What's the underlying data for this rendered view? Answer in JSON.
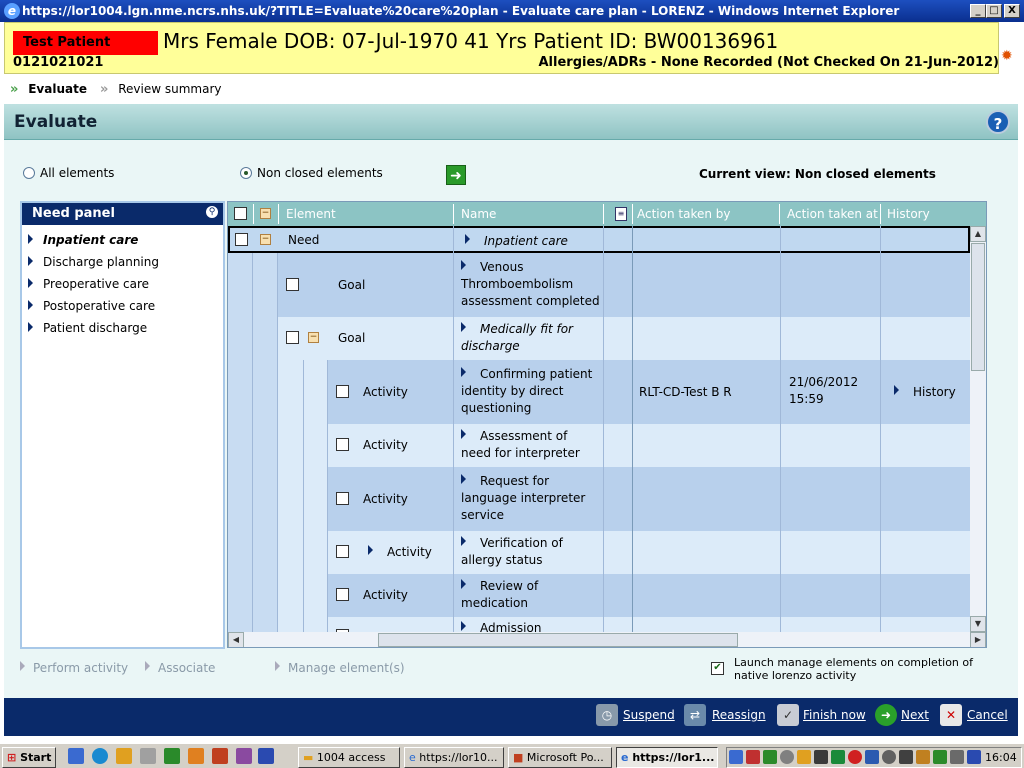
{
  "window": {
    "title": "https://lor1004.lgn.nme.ncrs.nhs.uk/?TITLE=Evaluate%20care%20plan - Evaluate care plan - LORENZ - Windows Internet Explorer",
    "min": "_",
    "max": "□",
    "close": "X"
  },
  "patient": {
    "name": "Test Patient",
    "demographics": "Mrs Female DOB: 07-Jul-1970 41 Yrs Patient ID: BW00136961",
    "nhs_number": "0121021021",
    "allergies": "Allergies/ADRs - None Recorded (Not Checked On 21-Jun-2012)"
  },
  "breadcrumb": [
    {
      "label": "Evaluate",
      "active": true
    },
    {
      "label": "Review summary",
      "active": false
    }
  ],
  "header": {
    "title": "Evaluate",
    "help": "?"
  },
  "filter": {
    "all_label": "All elements",
    "non_closed_label": "Non closed elements",
    "selected": "non_closed",
    "current_view": "Current view: Non closed elements"
  },
  "need_panel": {
    "title": "Need panel",
    "items": [
      {
        "label": "Inpatient care",
        "selected": true
      },
      {
        "label": "Discharge planning",
        "selected": false
      },
      {
        "label": "Preoperative care",
        "selected": false
      },
      {
        "label": "Postoperative care",
        "selected": false
      },
      {
        "label": "Patient discharge",
        "selected": false
      }
    ]
  },
  "grid": {
    "columns": [
      "Element",
      "Name",
      "Action taken by",
      "Action taken at",
      "History"
    ],
    "rows": [
      {
        "element": "Need",
        "name": "Inpatient care",
        "action_by": "",
        "action_at": "",
        "history": ""
      },
      {
        "element": "Goal",
        "name": "Venous Thromboembolism assessment completed",
        "action_by": "",
        "action_at": "",
        "history": ""
      },
      {
        "element": "Goal",
        "name": "Medically fit for discharge",
        "action_by": "",
        "action_at": "",
        "history": ""
      },
      {
        "element": "Activity",
        "name": "Confirming patient identity by direct questioning",
        "action_by": "RLT-CD-Test B R",
        "action_at": "21/06/2012 15:59",
        "history": "History"
      },
      {
        "element": "Activity",
        "name": "Assessment of need for interpreter",
        "action_by": "",
        "action_at": "",
        "history": ""
      },
      {
        "element": "Activity",
        "name": "Request for language interpreter service",
        "action_by": "",
        "action_at": "",
        "history": ""
      },
      {
        "element": "Activity",
        "name": "Verification of allergy status",
        "action_by": "",
        "action_at": "",
        "history": ""
      },
      {
        "element": "Activity",
        "name": "Review of medication",
        "action_by": "",
        "action_at": "",
        "history": ""
      },
      {
        "element": "",
        "name": "Admission",
        "action_by": "",
        "action_at": "",
        "history": ""
      }
    ]
  },
  "footer_actions": {
    "perform": "Perform activity",
    "associate": "Associate",
    "manage": "Manage element(s)",
    "launch_label": "Launch manage elements on completion of native lorenzo activity",
    "launch_checked": true
  },
  "bottom_buttons": {
    "suspend": "Suspend",
    "reassign": "Reassign",
    "finish": "Finish now",
    "next": "Next",
    "cancel": "Cancel"
  },
  "taskbar": {
    "start": "Start",
    "tasks": [
      "1004 access",
      "https://lor10...",
      "Microsoft Po...",
      "https://lor1..."
    ],
    "clock": "16:04"
  }
}
